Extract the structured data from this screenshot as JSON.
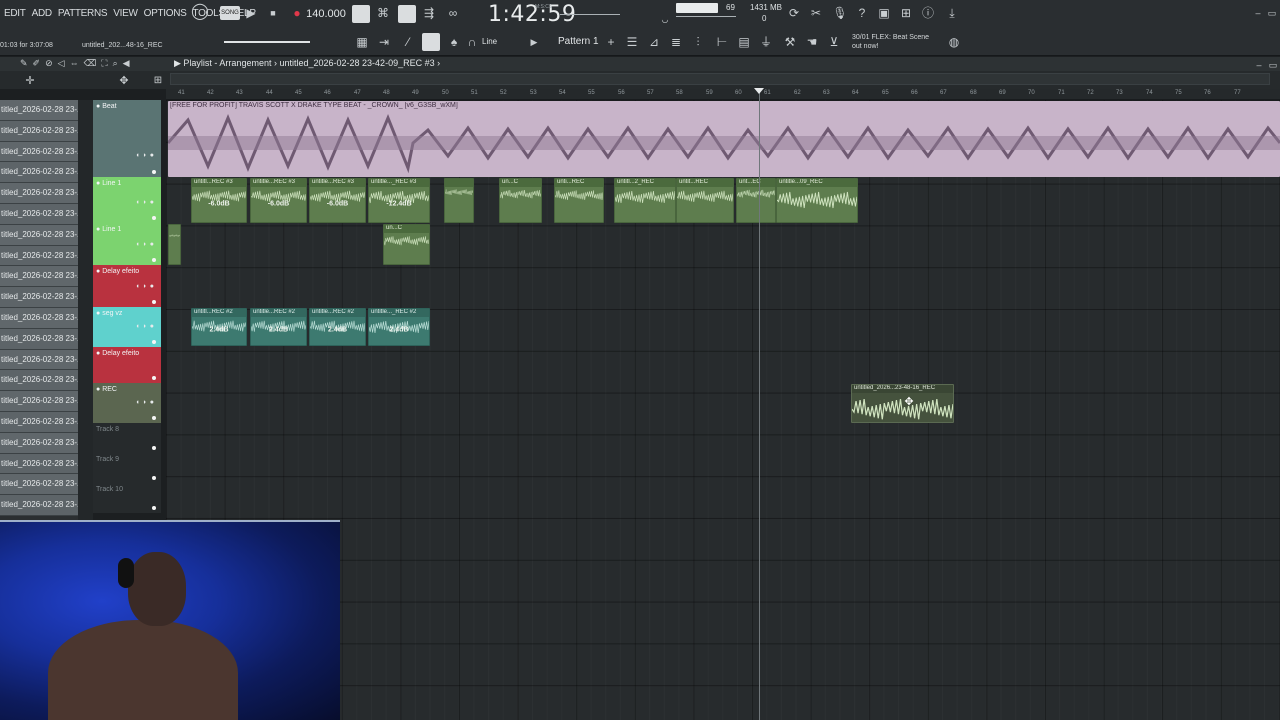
{
  "menu": [
    "EDIT",
    "ADD",
    "PATTERNS",
    "VIEW",
    "OPTIONS",
    "TOOLS",
    "HELP"
  ],
  "transport": {
    "tempo": "140.000",
    "time": "1:42:59",
    "time_label": "M:S:CS",
    "song_position": "01:03 for 3:07:08",
    "project_short": "untitled_202...48-16_REC"
  },
  "stats": {
    "cpu_value": "69",
    "memory": "1431 MB",
    "memory_sub": "0"
  },
  "toolbar": {
    "line_mode": "Line",
    "pattern": "Pattern 1"
  },
  "news": {
    "line1": "30/01  FLEX: Beat Scene",
    "line2": "out now!"
  },
  "playlist": {
    "title": "Playlist - Arrangement",
    "file": "untitled_2026-02-28 23-42-09_REC #3"
  },
  "ruler_numbers": [
    "41",
    "42",
    "43",
    "44",
    "45",
    "46",
    "47",
    "48",
    "49",
    "50",
    "51",
    "52",
    "53",
    "54",
    "55",
    "56",
    "57",
    "58",
    "59",
    "60",
    "61",
    "62",
    "63",
    "64",
    "65",
    "66",
    "67",
    "68",
    "69",
    "70",
    "71",
    "72",
    "73",
    "74",
    "75",
    "76",
    "77"
  ],
  "browser_items": [
    "titled_2026-02-28 23-...",
    "titled_2026-02-28 23-...",
    "titled_2026-02-28 23-...",
    "titled_2026-02-28 23-...",
    "titled_2026-02-28 23-...",
    "titled_2026-02-28 23-...",
    "titled_2026-02-28 23-...",
    "titled_2026-02-28 23-...",
    "titled_2026-02-28 23-...",
    "titled_2026-02-28 23-...",
    "titled_2026-02-28 23-...",
    "titled_2026-02-28 23-...",
    "titled_2026-02-28 23-...",
    "titled_2026-02-28 23-...",
    "titled_2026-02-28 23-...",
    "titled_2026-02-28 23-...",
    "titled_2026-02-28 23-...",
    "titled_2026-02-28 23-...",
    "titled_2026-02-28 23-...",
    "titled_2026-02-28 23-..."
  ],
  "tracks": [
    {
      "name": "Beat",
      "color": "#5a7473"
    },
    {
      "name": "Line 1",
      "color": "#7cd36f"
    },
    {
      "name": "Line 1",
      "color": "#7cd36f"
    },
    {
      "name": "Delay efeito",
      "color": "#b9323f"
    },
    {
      "name": "seg vz",
      "color": "#5fd1cd"
    },
    {
      "name": "Delay efeito",
      "color": "#b9323f"
    },
    {
      "name": "REC",
      "color": "#5b6650"
    },
    {
      "name": "Track 8",
      "color": "#262a2c"
    },
    {
      "name": "Track 9",
      "color": "#262a2c"
    },
    {
      "name": "Track 10",
      "color": "#262a2c"
    }
  ],
  "clips": {
    "beat_title": "[FREE FOR PROFIT] TRAVIS SCOTT X DRAKE TYPE BEAT - _CROWN_ [v6_G3SB_wXM]",
    "line1": [
      {
        "title": "untitl...REC #3",
        "gain": "-6.0dB"
      },
      {
        "title": "untitle...REC #3",
        "gain": "-6.0dB"
      },
      {
        "title": "untitle...REC #3",
        "gain": "-6.0dB"
      },
      {
        "title": "untitle..._REC #3",
        "gain": "-12.4dB"
      },
      {
        "title": "",
        "gain": ""
      },
      {
        "title": "un...C",
        "gain": ""
      },
      {
        "title": "unti...REC",
        "gain": ""
      },
      {
        "title": "untitl...2_REC",
        "gain": ""
      },
      {
        "title": "untit...REC",
        "gain": ""
      },
      {
        "title": "unt...EC",
        "gain": ""
      },
      {
        "title": "untitle...09_REC",
        "gain": ""
      }
    ],
    "line1b": {
      "title": "un...C"
    },
    "seg": [
      {
        "title": "untitl...REC #2",
        "gain": "2.4dB"
      },
      {
        "title": "untitle...REC #2",
        "gain": "2.4dB"
      },
      {
        "title": "untitle...REC #2",
        "gain": "2.4dB"
      },
      {
        "title": "untitle..._REC #2",
        "gain": "2.4dB"
      }
    ],
    "rec": {
      "title": "untitled_2026...23-48-16_REC"
    }
  }
}
